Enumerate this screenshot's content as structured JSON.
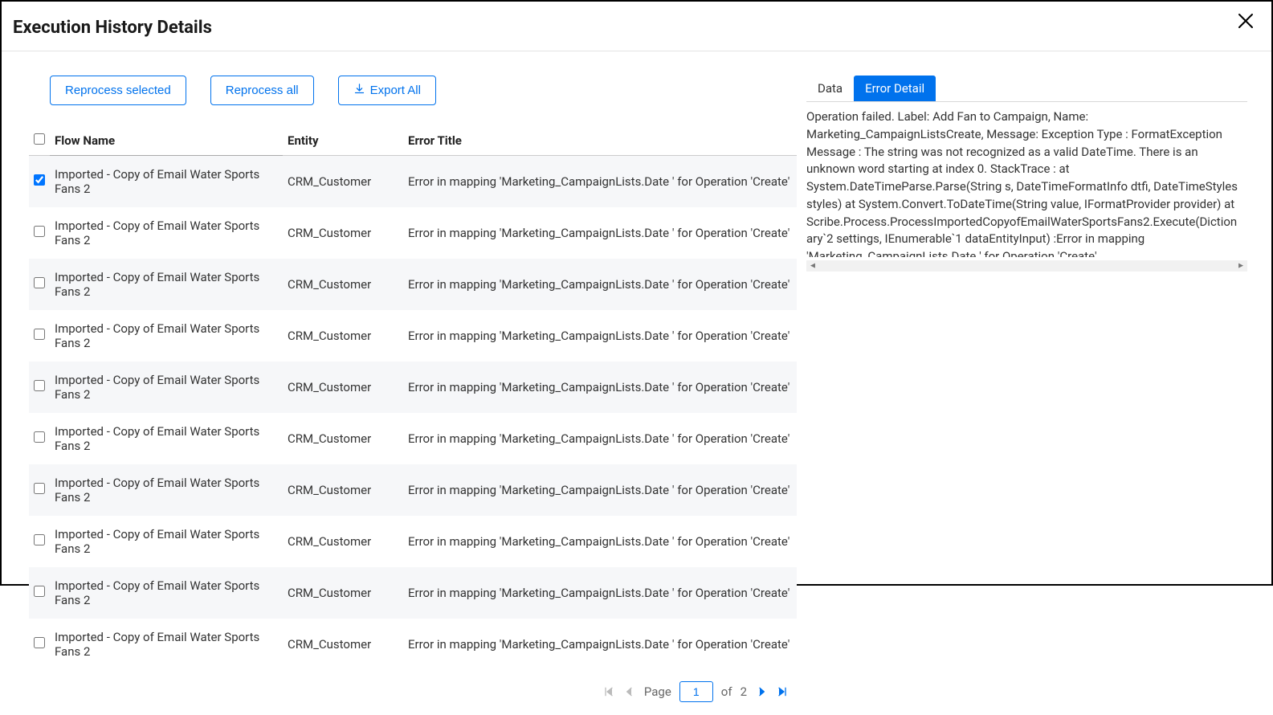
{
  "dialog": {
    "title": "Execution History Details"
  },
  "toolbar": {
    "reprocess_selected": "Reprocess selected",
    "reprocess_all": "Reprocess all",
    "export_all": "Export All"
  },
  "table": {
    "headers": {
      "flow": "Flow Name",
      "entity": "Entity",
      "error": "Error Title"
    },
    "rows": [
      {
        "checked": true,
        "flow": "Imported - Copy of Email Water Sports Fans 2",
        "entity": "CRM_Customer",
        "error": "Error in mapping 'Marketing_CampaignLists.Date ' for Operation 'Create'"
      },
      {
        "checked": false,
        "flow": "Imported - Copy of Email Water Sports Fans 2",
        "entity": "CRM_Customer",
        "error": "Error in mapping 'Marketing_CampaignLists.Date ' for Operation 'Create'"
      },
      {
        "checked": false,
        "flow": "Imported - Copy of Email Water Sports Fans 2",
        "entity": "CRM_Customer",
        "error": "Error in mapping 'Marketing_CampaignLists.Date ' for Operation 'Create'"
      },
      {
        "checked": false,
        "flow": "Imported - Copy of Email Water Sports Fans 2",
        "entity": "CRM_Customer",
        "error": "Error in mapping 'Marketing_CampaignLists.Date ' for Operation 'Create'"
      },
      {
        "checked": false,
        "flow": "Imported - Copy of Email Water Sports Fans 2",
        "entity": "CRM_Customer",
        "error": "Error in mapping 'Marketing_CampaignLists.Date ' for Operation 'Create'"
      },
      {
        "checked": false,
        "flow": "Imported - Copy of Email Water Sports Fans 2",
        "entity": "CRM_Customer",
        "error": "Error in mapping 'Marketing_CampaignLists.Date ' for Operation 'Create'"
      },
      {
        "checked": false,
        "flow": "Imported - Copy of Email Water Sports Fans 2",
        "entity": "CRM_Customer",
        "error": "Error in mapping 'Marketing_CampaignLists.Date ' for Operation 'Create'"
      },
      {
        "checked": false,
        "flow": "Imported - Copy of Email Water Sports Fans 2",
        "entity": "CRM_Customer",
        "error": "Error in mapping 'Marketing_CampaignLists.Date ' for Operation 'Create'"
      },
      {
        "checked": false,
        "flow": "Imported - Copy of Email Water Sports Fans 2",
        "entity": "CRM_Customer",
        "error": "Error in mapping 'Marketing_CampaignLists.Date ' for Operation 'Create'"
      },
      {
        "checked": false,
        "flow": "Imported - Copy of Email Water Sports Fans 2",
        "entity": "CRM_Customer",
        "error": "Error in mapping 'Marketing_CampaignLists.Date ' for Operation 'Create'"
      }
    ]
  },
  "pager": {
    "page_label": "Page",
    "current": "1",
    "of_label": "of",
    "total": "2"
  },
  "tabs": {
    "data": "Data",
    "error_detail": "Error Detail",
    "active": "error_detail"
  },
  "error_detail_text": "Operation failed. Label: Add Fan to Campaign, Name: Marketing_CampaignListsCreate, Message: Exception Type : FormatException Message : The string was not recognized as a valid DateTime. There is an unknown word starting at index 0. StackTrace : at System.DateTimeParse.Parse(String s, DateTimeFormatInfo dtfi, DateTimeStyles styles) at System.Convert.ToDateTime(String value, IFormatProvider provider) at Scribe.Process.ProcessImportedCopyofEmailWaterSportsFans2.Execute(Dictionary`2 settings, IEnumerable`1 dataEntityInput) :Error in mapping 'Marketing_CampaignLists.Date ' for Operation 'Create'"
}
